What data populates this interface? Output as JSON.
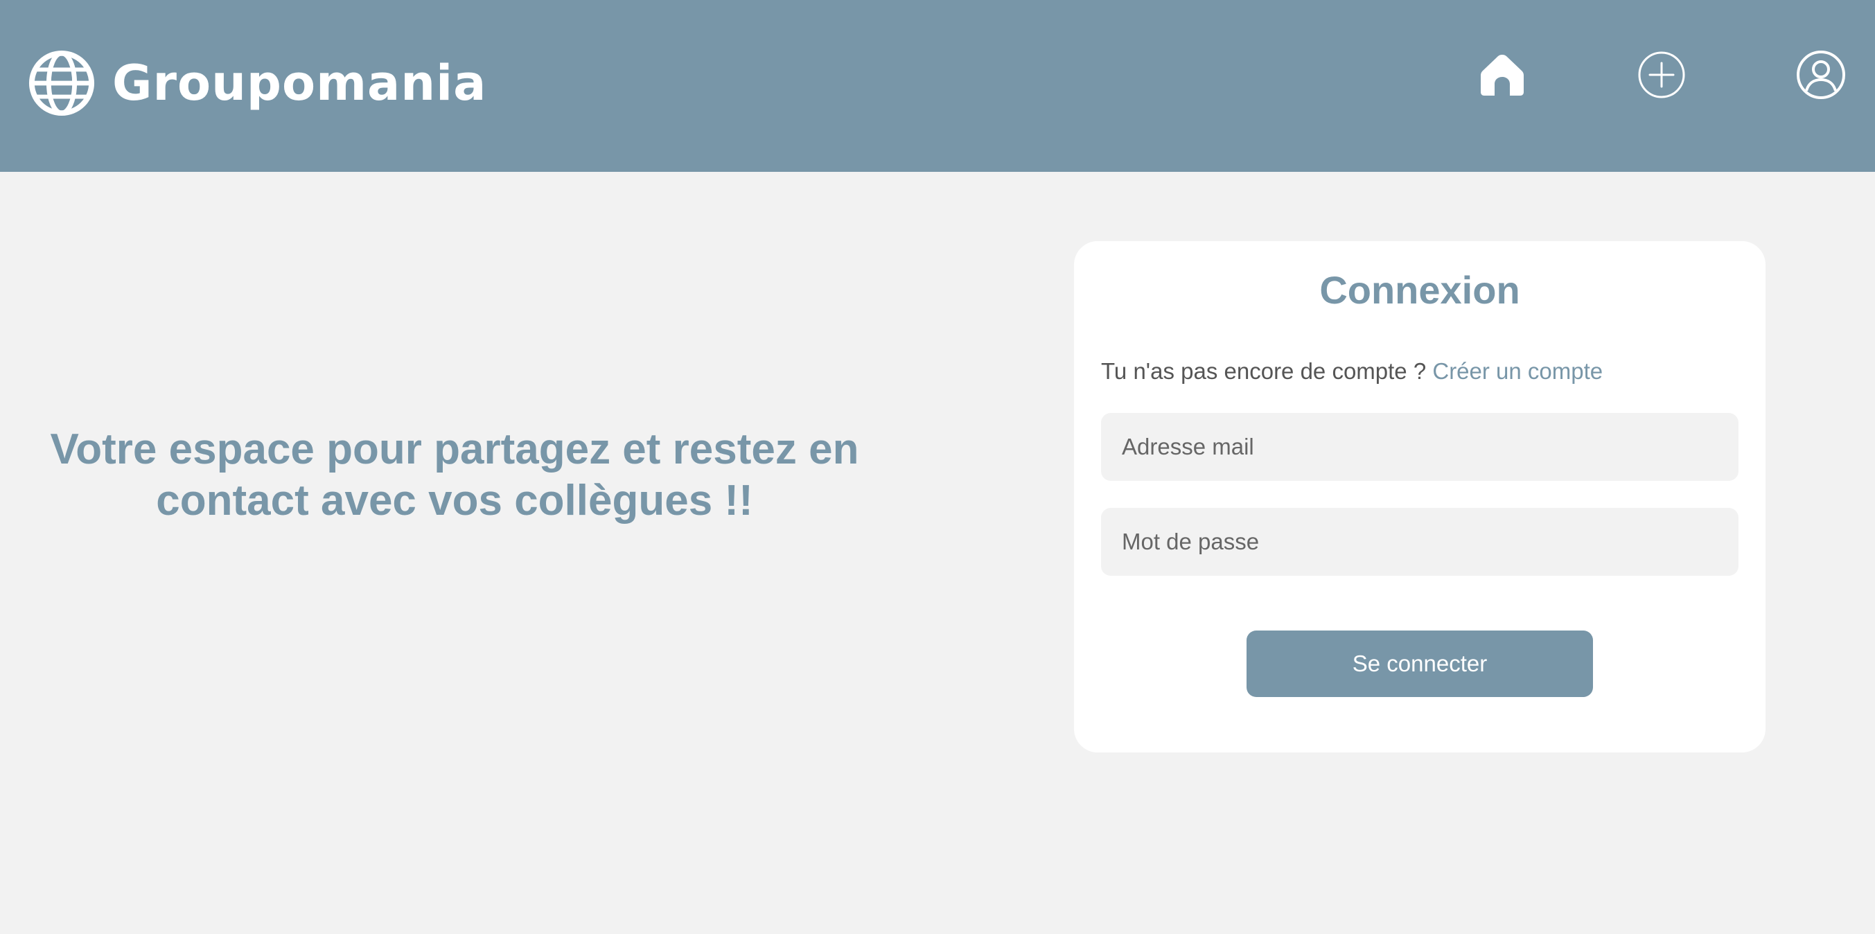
{
  "header": {
    "brand_name": "Groupomania",
    "brand_icon": "globe-icon",
    "nav": [
      {
        "id": "home",
        "icon": "home-icon"
      },
      {
        "id": "add",
        "icon": "plus-circle-icon"
      },
      {
        "id": "profile",
        "icon": "user-circle-icon"
      }
    ]
  },
  "hero": {
    "line1": "Votre espace pour partagez et restez en",
    "line2": "contact avec vos collègues !!"
  },
  "login": {
    "title": "Connexion",
    "signup_prompt": "Tu n'as pas encore de compte ?",
    "signup_link": "Créer un compte",
    "email_placeholder": "Adresse mail",
    "email_value": "",
    "password_placeholder": "Mot de passe",
    "password_value": "",
    "submit_label": "Se connecter"
  },
  "colors": {
    "accent": "#7896a8",
    "background": "#f2f2f2",
    "card": "#ffffff",
    "text": "#555555"
  }
}
